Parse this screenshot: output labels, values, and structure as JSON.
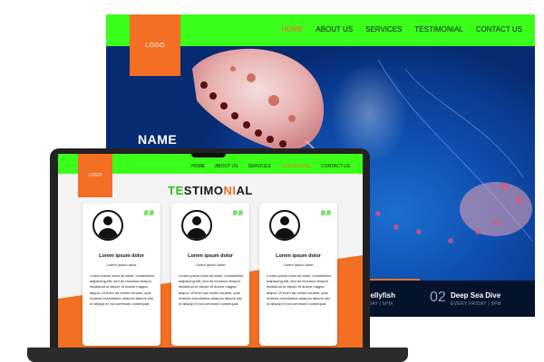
{
  "desktop": {
    "logo": "LOGO",
    "menu": [
      "HOME",
      "ABOUT US",
      "SERVICES",
      "TESTIMONIAL",
      "CONTACT US"
    ],
    "hero_name": "NAME",
    "events": [
      {
        "number": "",
        "title": "Jellyfish",
        "subtitle": "UESDAY | 6PM"
      },
      {
        "number": "02",
        "title": "Deep Sea Dive",
        "subtitle": "EVERY FRIDAY | 9PM"
      }
    ]
  },
  "laptop": {
    "logo": "LOGO",
    "menu": [
      "HOME",
      "ABOUT US",
      "SERVICES",
      "TESTIMONIAL",
      "CONTACT US"
    ],
    "heading": {
      "part1": "TE",
      "part2": "STIMO",
      "part3": "NI",
      "part4": "AL"
    },
    "cards": [
      {
        "title": "Lorem ipsum dolor",
        "subtitle": "Lorem ipsum dolor",
        "body": "Lorem ipsum dolor sit amet, consectetur adipiscing elit, sed do eiusmod tempor incididunt ut labore et dolore magna aliqua. Ut enim ad minim veniam, quis nostrud exercitation ullamco laboris nisi ut aliquip ex ea commodo consequat."
      },
      {
        "title": "Lorem ipsum dolor",
        "subtitle": "Lorem ipsum dolor",
        "body": "Lorem ipsum dolor sit amet, consectetur adipiscing elit, sed do eiusmod tempor incididunt ut labore et dolore magna aliqua. Ut enim ad minim veniam, quis nostrud exercitation ullamco laboris nisi ut aliquip ex ea commodo consequat."
      },
      {
        "title": "Lorem ipsum dolor",
        "subtitle": "Lorem ipsum dolor",
        "body": "Lorem ipsum dolor sit amet, consectetur adipiscing elit, sed do eiusmod tempor incididunt ut labore et dolore magna aliqua. Ut enim ad minim veniam, quis nostrud exercitation ullamco laboris nisi ut aliquip ex ea commodo consequat."
      }
    ]
  },
  "colors": {
    "nav_green": "#3bff1a",
    "accent_orange": "#f26f24",
    "heading_green": "#2fbf1a",
    "ocean_blue": "#0e4fb0"
  },
  "icons": [
    "user-avatar-icon",
    "quote-icon"
  ]
}
